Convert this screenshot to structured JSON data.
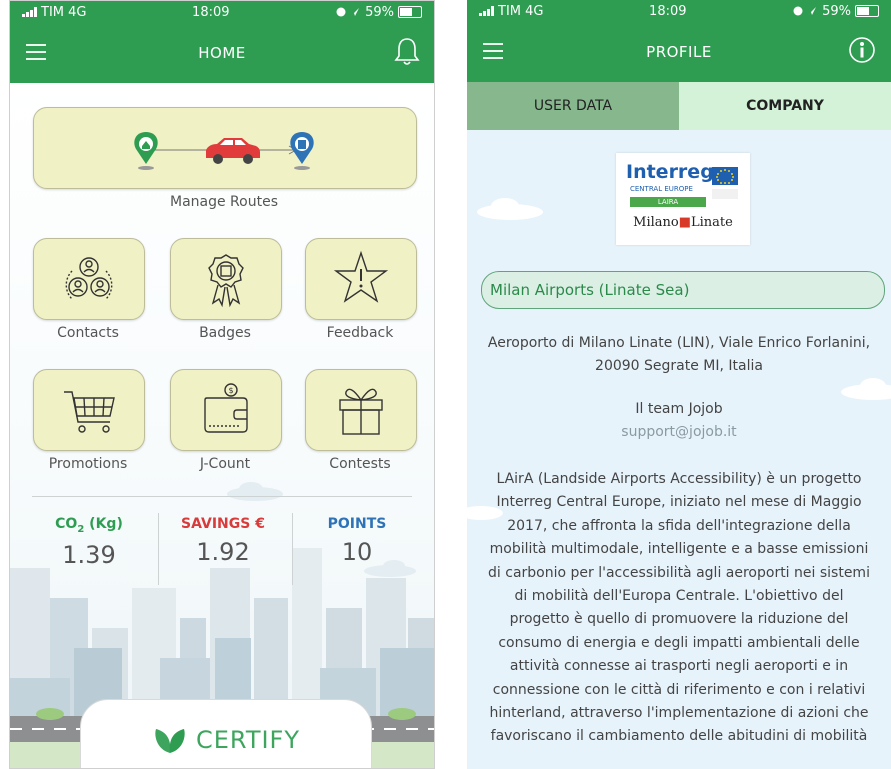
{
  "left": {
    "status_bar": {
      "carrier": "TIM 4G",
      "time": "18:09",
      "battery": "59%"
    },
    "nav": {
      "title": "HOME"
    },
    "manage_routes": {
      "label": "Manage Routes"
    },
    "tiles": [
      {
        "label": "Contacts",
        "icon": "contacts-icon"
      },
      {
        "label": "Badges",
        "icon": "badge-icon"
      },
      {
        "label": "Feedback",
        "icon": "star-icon"
      },
      {
        "label": "Promotions",
        "icon": "cart-icon"
      },
      {
        "label": "J-Count",
        "icon": "wallet-icon"
      },
      {
        "label": "Contests",
        "icon": "gift-icon"
      }
    ],
    "stats": {
      "co2": {
        "label_prefix": "CO",
        "label_sub": "2",
        "label_suffix": " (Kg)",
        "value": "1.39"
      },
      "savings": {
        "label": "SAVINGS €",
        "value": "1.92"
      },
      "points": {
        "label": "POINTS",
        "value": "10"
      }
    },
    "certify": {
      "label": "CERTIFY"
    },
    "colors": {
      "green": "#2e9d52",
      "savings": "#d93a3a",
      "points": "#2f73b7"
    }
  },
  "right": {
    "status_bar": {
      "carrier": "TIM 4G",
      "time": "18:09",
      "battery": "59%"
    },
    "nav": {
      "title": "PROFILE"
    },
    "tabs": [
      {
        "label": "USER DATA"
      },
      {
        "label": "COMPANY"
      }
    ],
    "logo": {
      "title": "Interreg",
      "line1": "CENTRAL EUROPE",
      "line2": "LAIRA",
      "line3_a": "Milano",
      "line3_b": "Linate"
    },
    "company": {
      "name": "Milan Airports (Linate Sea)",
      "address_line1": "Aeroporto di Milano Linate (LIN), Viale Enrico Forlanini,",
      "address_line2": "20090 Segrate MI, Italia",
      "team": "Il team Jojob",
      "email": "support@jojob.it",
      "description": [
        "LAirA (Landside Airports Accessibility) è un progetto",
        "Interreg Central Europe, iniziato nel mese di Maggio",
        "2017, che affronta la sfida dell'integrazione della",
        "mobilità multimodale, intelligente e a basse emissioni",
        "di carbonio per l'accessibilità agli aeroporti nei sistemi",
        "di mobilità dell'Europa Centrale. L'obiettivo del",
        "progetto è quello di promuovere la riduzione del",
        "consumo di energia e degli impatti ambientali delle",
        "attività connesse ai trasporti negli aeroporti e in",
        "connessione con le città di riferimento e con i relativi",
        "hinterland, attraverso l'implementazione di azioni che",
        "favoriscano il cambiamento delle abitudini di mobilità"
      ]
    }
  }
}
